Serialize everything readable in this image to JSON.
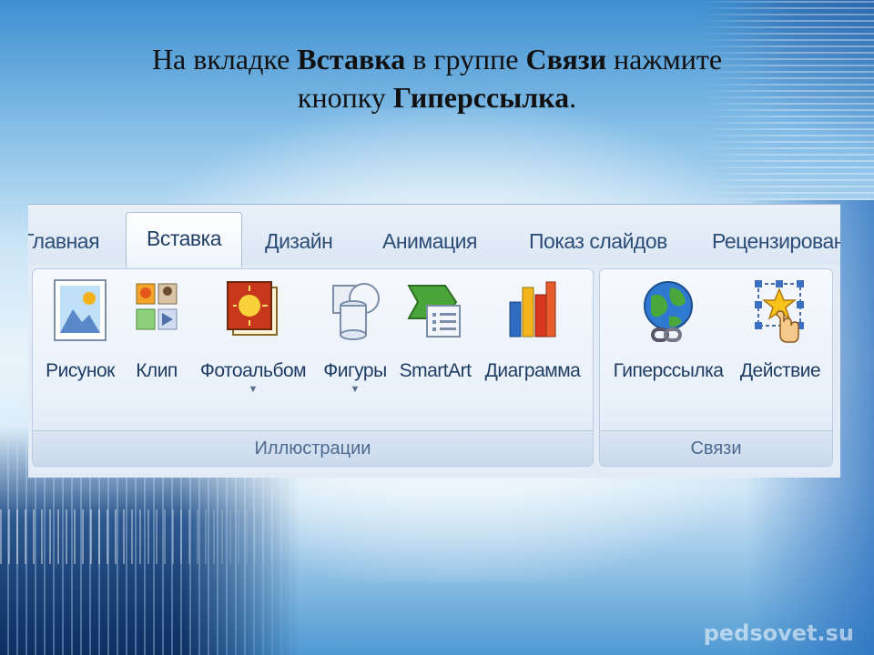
{
  "heading": {
    "line1_prefix": "На вкладке ",
    "tab_name": "Вставка",
    "line1_middle": " в группе ",
    "group_name": "Связи",
    "line1_suffix": " нажмите",
    "line2_prefix": "кнопку ",
    "button_name": "Гиперссылка",
    "line2_suffix": "."
  },
  "ribbon": {
    "tabs": [
      "Главная",
      "Вставка",
      "Дизайн",
      "Анимация",
      "Показ слайдов",
      "Рецензирован"
    ],
    "active_tab": "Вставка",
    "groups": [
      {
        "label": "Иллюстрации",
        "buttons": [
          {
            "label": "Рисунок",
            "icon": "picture-icon"
          },
          {
            "label": "Клип",
            "icon": "clipart-icon"
          },
          {
            "label": "Фотоальбом",
            "icon": "photo-album-icon",
            "dropdown": true
          },
          {
            "label": "Фигуры",
            "icon": "shapes-icon",
            "dropdown": true
          },
          {
            "label": "SmartArt",
            "icon": "smartart-icon"
          },
          {
            "label": "Диаграмма",
            "icon": "chart-icon"
          }
        ]
      },
      {
        "label": "Связи",
        "buttons": [
          {
            "label": "Гиперссылка",
            "icon": "hyperlink-globe-icon"
          },
          {
            "label": "Действие",
            "icon": "action-star-icon"
          }
        ]
      }
    ]
  },
  "watermark": "pedsovet.su",
  "colors": {
    "ribbon_text": "#1f3d63",
    "tab_text": "#2b4d78",
    "heading_text": "#111111"
  }
}
